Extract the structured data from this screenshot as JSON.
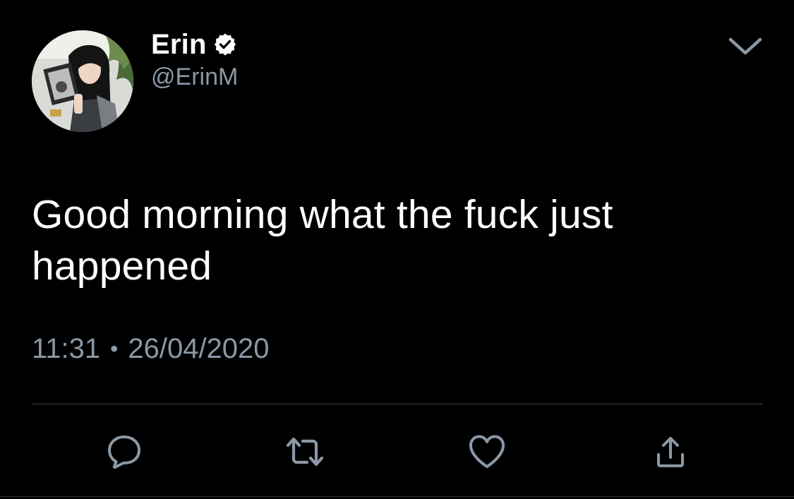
{
  "user": {
    "display_name": "Erin",
    "handle": "@ErinM",
    "verified": true,
    "verified_icon": "verified-badge-icon",
    "avatar": "profile-photo"
  },
  "tweet": {
    "text": "Good morning what the fuck just happened",
    "time": "11:31",
    "separator": "•",
    "date": "26/04/2020"
  },
  "actions": [
    {
      "name": "reply",
      "icon": "speech-bubble-icon"
    },
    {
      "name": "retweet",
      "icon": "retweet-arrows-icon"
    },
    {
      "name": "like",
      "icon": "heart-icon"
    },
    {
      "name": "share",
      "icon": "share-upload-icon"
    }
  ],
  "colors": {
    "background": "#000000",
    "primary_text": "#ffffff",
    "secondary_text": "#8b98a5",
    "divider": "#38444d"
  }
}
